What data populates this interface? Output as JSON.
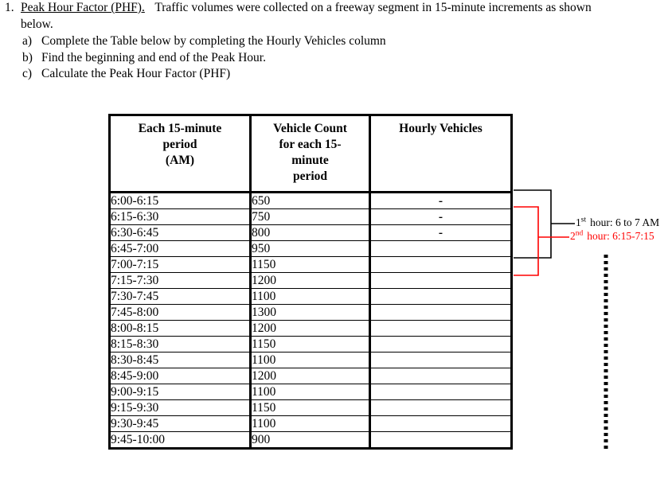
{
  "problem": {
    "number": "1.",
    "title": "Peak Hour Factor (PHF).",
    "intro": "Traffic volumes were collected on a freeway segment in 15-minute increments as shown below.",
    "sub_items": [
      {
        "marker": "a)",
        "text": "Complete the Table below by completing the Hourly Vehicles column"
      },
      {
        "marker": "b)",
        "text": "Find the beginning and end of the Peak Hour."
      },
      {
        "marker": "c)",
        "text": "Calculate the Peak Hour Factor (PHF)"
      }
    ]
  },
  "table": {
    "headers": [
      "Each 15-minute period (AM)",
      "Vehicle Count for each 15-minute period",
      "Hourly Vehicles"
    ],
    "header_lines": {
      "col1": [
        "Each 15-minute",
        "period",
        "(AM)"
      ],
      "col2": [
        "Vehicle Count",
        "for each 15-",
        "minute",
        "period"
      ],
      "col3": [
        "Hourly Vehicles"
      ]
    },
    "rows": [
      {
        "period": "6:00-6:15",
        "count": "650",
        "hourly": "-"
      },
      {
        "period": "6:15-6:30",
        "count": "750",
        "hourly": "-"
      },
      {
        "period": "6:30-6:45",
        "count": "800",
        "hourly": "-"
      },
      {
        "period": "6:45-7:00",
        "count": "950",
        "hourly": ""
      },
      {
        "period": "7:00-7:15",
        "count": "1150",
        "hourly": ""
      },
      {
        "period": "7:15-7:30",
        "count": "1200",
        "hourly": ""
      },
      {
        "period": "7:30-7:45",
        "count": "1100",
        "hourly": ""
      },
      {
        "period": "7:45-8:00",
        "count": "1300",
        "hourly": ""
      },
      {
        "period": "8:00-8:15",
        "count": "1200",
        "hourly": ""
      },
      {
        "period": "8:15-8:30",
        "count": "1150",
        "hourly": ""
      },
      {
        "period": "8:30-8:45",
        "count": "1100",
        "hourly": ""
      },
      {
        "period": "8:45-9:00",
        "count": "1200",
        "hourly": ""
      },
      {
        "period": "9:00-9:15",
        "count": "1100",
        "hourly": ""
      },
      {
        "period": "9:15-9:30",
        "count": "1150",
        "hourly": ""
      },
      {
        "period": "9:30-9:45",
        "count": "1100",
        "hourly": ""
      },
      {
        "period": "9:45-10:00",
        "count": "900",
        "hourly": ""
      }
    ]
  },
  "annotations": {
    "first_hour": {
      "ordinal_number": "1",
      "ordinal_suffix": "st",
      "text": "hour: 6 to 7 AM",
      "color": "#000000"
    },
    "second_hour": {
      "ordinal_number": "2",
      "ordinal_suffix": "nd",
      "text": "hour: 6:15-7:15",
      "color": "#ff0000"
    }
  },
  "colors": {
    "black": "#000000",
    "red": "#ff0000",
    "background": "#ffffff"
  }
}
